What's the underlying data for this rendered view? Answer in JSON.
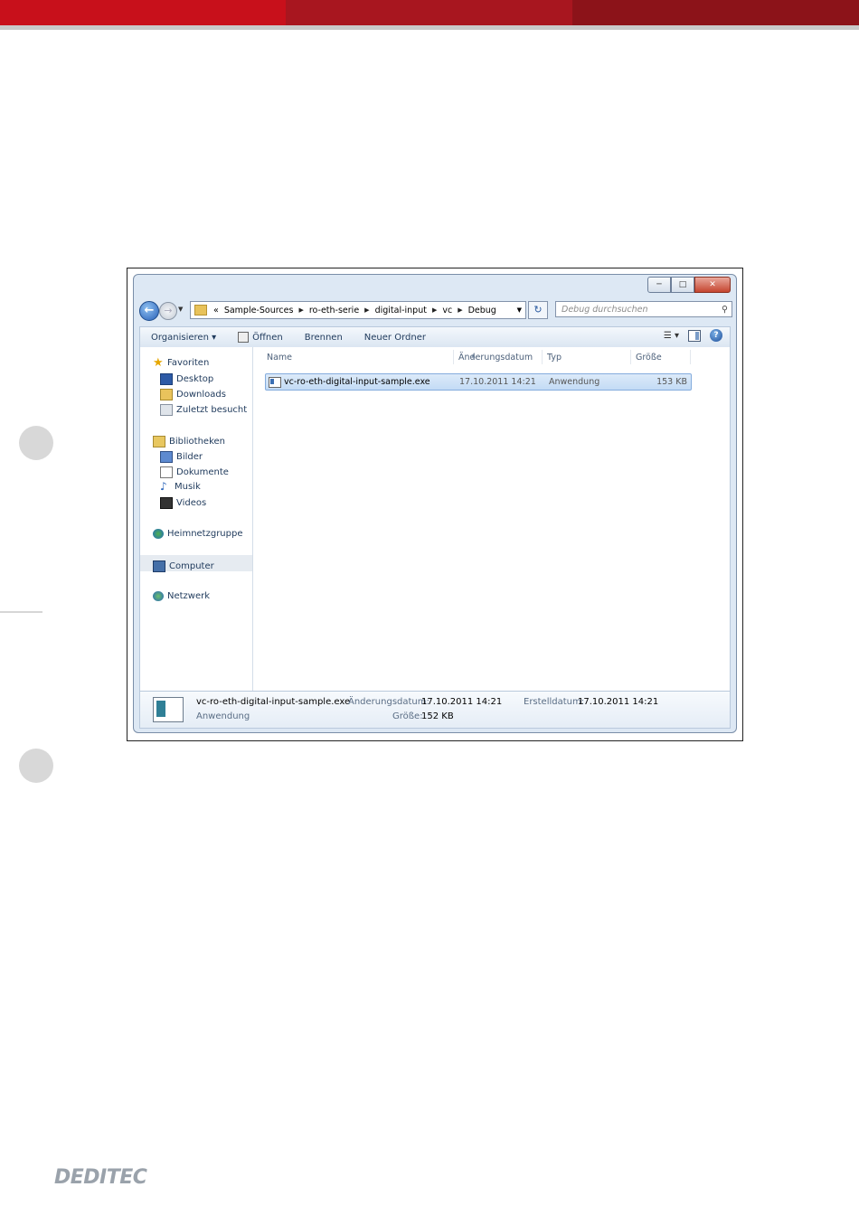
{
  "explorer": {
    "address": {
      "overflow": "«",
      "segments": [
        "Sample-Sources",
        "ro-eth-serie",
        "digital-input",
        "vc",
        "Debug"
      ]
    },
    "search_placeholder": "Debug durchsuchen",
    "toolbar": {
      "organize": "Organisieren ▾",
      "open": "Öffnen",
      "burn": "Brennen",
      "new_folder": "Neuer Ordner"
    },
    "nav": {
      "favorites": "Favoriten",
      "desktop": "Desktop",
      "downloads": "Downloads",
      "recent": "Zuletzt besucht",
      "libraries": "Bibliotheken",
      "pictures": "Bilder",
      "documents": "Dokumente",
      "music": "Musik",
      "videos": "Videos",
      "homegroup": "Heimnetzgruppe",
      "computer": "Computer",
      "network": "Netzwerk"
    },
    "columns": {
      "name": "Name",
      "modified": "Änderungsdatum",
      "type": "Typ",
      "size": "Größe"
    },
    "file": {
      "name": "vc-ro-eth-digital-input-sample.exe",
      "modified": "17.10.2011 14:21",
      "type": "Anwendung",
      "size": "153 KB"
    },
    "details": {
      "name": "vc-ro-eth-digital-input-sample.exe",
      "type": "Anwendung",
      "modified_label": "Änderungsdatum:",
      "modified_value": "17.10.2011 14:21",
      "size_label": "Größe:",
      "size_value": "152 KB",
      "created_label": "Erstelldatum:",
      "created_value": "17.10.2011 14:21"
    }
  },
  "logo": {
    "text": "DEDITEC"
  }
}
